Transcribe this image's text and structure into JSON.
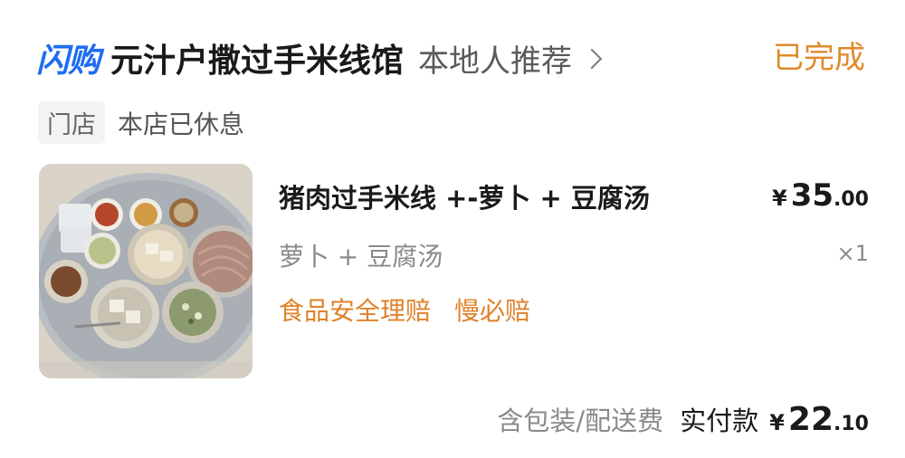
{
  "header": {
    "brand_logo": "闪购",
    "store_name": "元汁户撒过手米线馆",
    "store_tag": "本地人推荐",
    "order_status": "已完成"
  },
  "store": {
    "chip": "门店",
    "state": "本店已休息"
  },
  "item": {
    "name": "猪肉过手米线 +-萝卜 + 豆腐汤",
    "price_symbol": "¥",
    "price_int": "35",
    "price_dec": ".00",
    "spec": "萝卜 + 豆腐汤",
    "quantity": "×1",
    "guarantees": [
      "食品安全理赔",
      "慢必赔"
    ]
  },
  "total": {
    "note": "含包装/配送费",
    "label": "实付款",
    "price_symbol": "¥",
    "price_int": "22",
    "price_dec": ".10"
  },
  "colors": {
    "brand_blue": "#1e6cf2",
    "brand_orange": "#ff8a00",
    "status_orange": "#e08a2c"
  }
}
